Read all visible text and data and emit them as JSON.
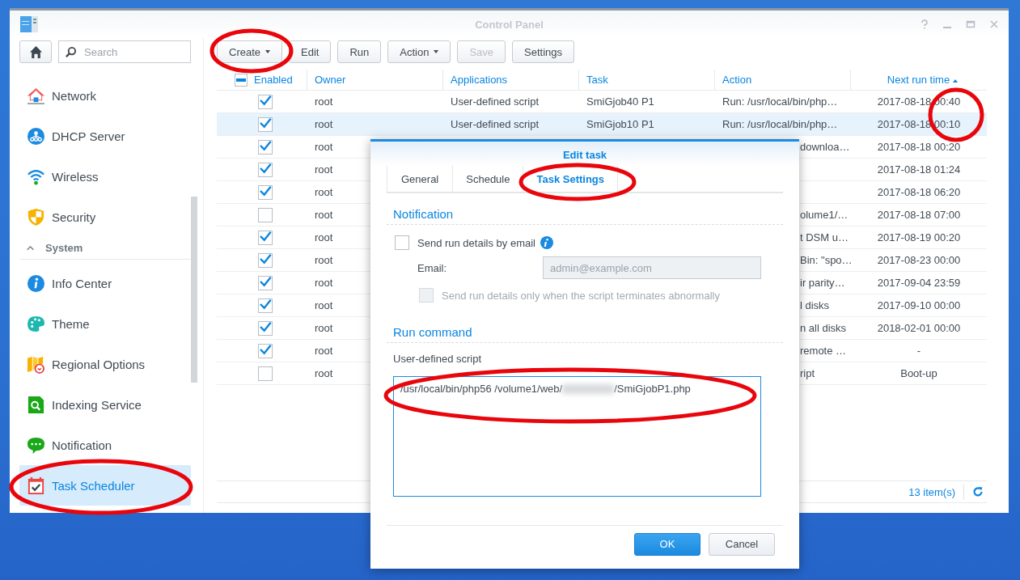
{
  "window": {
    "title": "Control Panel"
  },
  "sidebar": {
    "search": {
      "placeholder": "Search"
    },
    "items": [
      {
        "kind": "item",
        "label": "Network",
        "selected": false
      },
      {
        "kind": "item",
        "label": "DHCP Server",
        "selected": false
      },
      {
        "kind": "item",
        "label": "Wireless",
        "selected": false
      },
      {
        "kind": "item",
        "label": "Security",
        "selected": false
      },
      {
        "kind": "section",
        "label": "System",
        "expanded": true
      },
      {
        "kind": "item",
        "label": "Info Center",
        "selected": false
      },
      {
        "kind": "item",
        "label": "Theme",
        "selected": false
      },
      {
        "kind": "item",
        "label": "Regional Options",
        "selected": false
      },
      {
        "kind": "item",
        "label": "Indexing Service",
        "selected": false
      },
      {
        "kind": "item",
        "label": "Notification",
        "selected": false
      },
      {
        "kind": "item",
        "label": "Task Scheduler",
        "selected": true
      }
    ]
  },
  "toolbar": [
    {
      "label": "Create",
      "dropdown": true,
      "disabled": false
    },
    {
      "label": "Edit",
      "dropdown": false,
      "disabled": false
    },
    {
      "label": "Run",
      "dropdown": false,
      "disabled": false
    },
    {
      "label": "Action",
      "dropdown": true,
      "disabled": false
    },
    {
      "label": "Save",
      "dropdown": false,
      "disabled": true
    },
    {
      "label": "Settings",
      "dropdown": false,
      "disabled": false
    }
  ],
  "table": {
    "columns": [
      {
        "label": "Enabled",
        "kind": "check",
        "indeterminate": true
      },
      {
        "label": "Owner",
        "kind": "text"
      },
      {
        "label": "Applications",
        "kind": "text"
      },
      {
        "label": "Task",
        "kind": "text"
      },
      {
        "label": "Action",
        "kind": "text"
      },
      {
        "label": "Next run time",
        "kind": "text",
        "sorted_ascending": true
      }
    ],
    "rows": [
      {
        "enabled": true,
        "selected": false,
        "owner": "root",
        "applications": "User-defined script",
        "task": "SmiGjob40 P1",
        "action": "Run: /usr/local/bin/php…",
        "next_run_time": "2017-08-18 00:40"
      },
      {
        "enabled": true,
        "selected": true,
        "owner": "root",
        "applications": "User-defined script",
        "task": "SmiGjob10 P1",
        "action": "Run: /usr/local/bin/php…",
        "next_run_time": "2017-08-18 00:10"
      },
      {
        "enabled": true,
        "selected": false,
        "owner": "root",
        "action_tail": "downloa…",
        "next_run_time": "2017-08-18 00:20"
      },
      {
        "enabled": true,
        "selected": false,
        "owner": "root",
        "next_run_time": "2017-08-18 01:24"
      },
      {
        "enabled": true,
        "selected": false,
        "owner": "root",
        "next_run_time": "2017-08-18 06:20"
      },
      {
        "enabled": false,
        "selected": false,
        "owner": "root",
        "action_tail": "olume1/…",
        "next_run_time": "2017-08-18 07:00"
      },
      {
        "enabled": true,
        "selected": false,
        "owner": "root",
        "action_tail": "t DSM u…",
        "next_run_time": "2017-08-19 00:20"
      },
      {
        "enabled": true,
        "selected": false,
        "owner": "root",
        "action_tail": "Bin: \"spo…",
        "next_run_time": "2017-08-23 00:00"
      },
      {
        "enabled": true,
        "selected": false,
        "owner": "root",
        "action_tail": "ir parity…",
        "next_run_time": "2017-09-04 23:59"
      },
      {
        "enabled": true,
        "selected": false,
        "owner": "root",
        "action_tail": "l disks",
        "next_run_time": "2017-09-10 00:00"
      },
      {
        "enabled": true,
        "selected": false,
        "owner": "root",
        "action_tail": "n all disks",
        "next_run_time": "2018-02-01 00:00"
      },
      {
        "enabled": true,
        "selected": false,
        "owner": "root",
        "action_tail": "remote …",
        "next_run_time": "-"
      },
      {
        "enabled": false,
        "selected": false,
        "owner": "root",
        "action_tail": "ript",
        "next_run_time": "Boot-up"
      }
    ]
  },
  "status_bar": {
    "count": "13 item(s)"
  },
  "dialog": {
    "title": "Edit task",
    "tabs": [
      {
        "label": "General",
        "selected": false
      },
      {
        "label": "Schedule",
        "selected": false
      },
      {
        "label": "Task Settings",
        "selected": true
      }
    ],
    "notification": {
      "heading": "Notification",
      "email_option": {
        "label": "Send run details by email",
        "checked": false
      },
      "email": {
        "label": "Email:",
        "placeholder": "admin@example.com",
        "disabled": true
      },
      "abnormal_option": {
        "label": "Send run details only when the script terminates abnormally",
        "checked": false,
        "disabled": true
      }
    },
    "run_command": {
      "heading": "Run command",
      "label": "User-defined script",
      "command_parts": [
        "/usr/local/bin/php56 /volume1/web/",
        "/SmiGjobP1.php"
      ]
    },
    "buttons": [
      {
        "label": "OK",
        "kind": "primary"
      },
      {
        "label": "Cancel",
        "kind": "secondary"
      }
    ]
  }
}
